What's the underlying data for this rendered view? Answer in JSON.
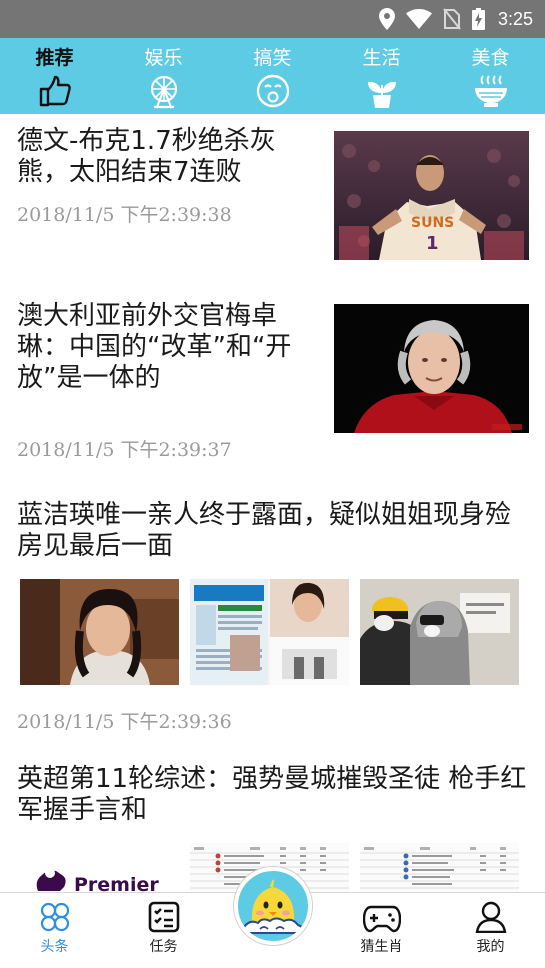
{
  "status_bar": {
    "time": "3:25",
    "icons": [
      "location-icon",
      "wifi-icon",
      "no-sim-icon",
      "battery-charging-icon"
    ]
  },
  "category_tabs": [
    {
      "label": "推荐",
      "icon": "thumbs-up-icon",
      "active": true
    },
    {
      "label": "娱乐",
      "icon": "ferris-wheel-icon",
      "active": false
    },
    {
      "label": "搞笑",
      "icon": "laughing-face-icon",
      "active": false
    },
    {
      "label": "生活",
      "icon": "potted-plant-icon",
      "active": false
    },
    {
      "label": "美食",
      "icon": "noodle-bowl-icon",
      "active": false
    }
  ],
  "news": [
    {
      "title": "德文-布克1.7秒绝杀灰熊，太阳结束7连败",
      "time": "2018/11/5 下午2:39:38",
      "layout": "right-thumbnail",
      "thumbnail": "basketball-player-photo",
      "jersey_text": "SUNS",
      "jersey_number": "1"
    },
    {
      "title": "澳大利亚前外交官梅卓琳：中国的“改革”和“开放”是一体的",
      "time": "2018/11/5 下午2:39:37",
      "layout": "right-thumbnail",
      "thumbnail": "elderly-woman-portrait"
    },
    {
      "title": "蓝洁瑛唯一亲人终于露面，疑似姐姐现身殓房见最后一面",
      "time": "2018/11/5 下午2:39:36",
      "layout": "three-thumbnails",
      "thumbnails": [
        "actress-photo",
        "newspaper-clipping-photo",
        "masked-person-photo"
      ]
    },
    {
      "title": "英超第11轮综述：强势曼城摧毁圣徒 枪手红军握手言和",
      "layout": "three-thumbnails",
      "thumbnails": [
        "premier-league-logo",
        "league-table-image",
        "league-table-image-2"
      ],
      "logo_text": "Premier"
    }
  ],
  "bottom_nav": [
    {
      "label": "头条",
      "icon": "clover-icon",
      "active": true
    },
    {
      "label": "任务",
      "icon": "task-list-icon",
      "active": false
    },
    {
      "label": "",
      "icon": "mascot-chick-icon",
      "active": false
    },
    {
      "label": "猜生肖",
      "icon": "gamepad-icon",
      "active": false
    },
    {
      "label": "我的",
      "icon": "user-icon",
      "active": false
    }
  ]
}
